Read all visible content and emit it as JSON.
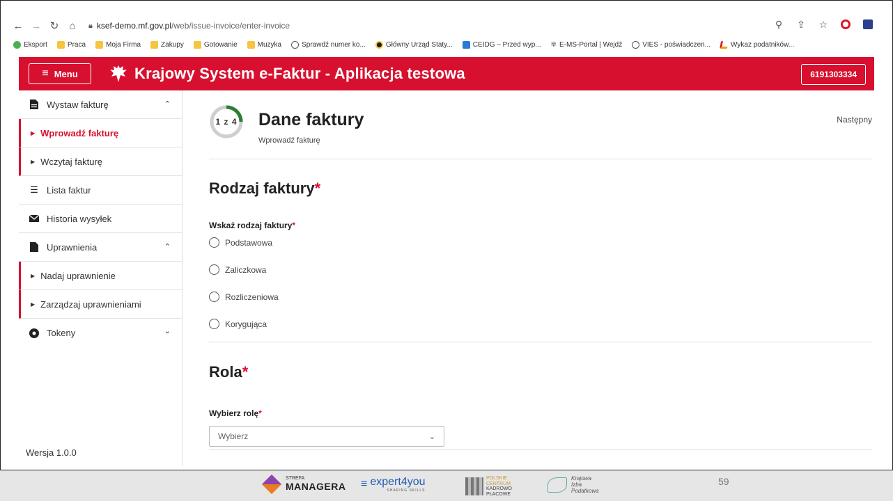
{
  "browser": {
    "url_host": "ksef-demo.mf.gov.pl",
    "url_path": "/web/issue-invoice/enter-invoice",
    "bookmarks": [
      {
        "label": "Eksport",
        "icon": "green-globe"
      },
      {
        "label": "Praca",
        "icon": "folder"
      },
      {
        "label": "Moja Firma",
        "icon": "folder"
      },
      {
        "label": "Zakupy",
        "icon": "folder"
      },
      {
        "label": "Gotowanie",
        "icon": "folder"
      },
      {
        "label": "Muzyka",
        "icon": "folder"
      },
      {
        "label": "Sprawdź numer ko...",
        "icon": "globe"
      },
      {
        "label": "Główny Urząd Staty...",
        "icon": "dot-yellow"
      },
      {
        "label": "CEIDG – Przed wyp...",
        "icon": "ceidg"
      },
      {
        "label": "E-MS-Portal | Wejdź",
        "icon": "eagle-sm"
      },
      {
        "label": "VIES - poświadczen...",
        "icon": "globe"
      },
      {
        "label": "Wykaz podatników...",
        "icon": "wykaz"
      }
    ]
  },
  "header": {
    "menu_label": "Menu",
    "title": "Krajowy System e-Faktur - Aplikacja testowa",
    "nip": "6191303334"
  },
  "sidebar": {
    "wystaw": "Wystaw fakturę",
    "wprowadz": "Wprowadź fakturę",
    "wczytaj": "Wczytaj fakturę",
    "lista": "Lista faktur",
    "historia": "Historia wysyłek",
    "uprawnienia": "Uprawnienia",
    "nadaj": "Nadaj uprawnienie",
    "zarzadzaj": "Zarządzaj uprawnieniami",
    "tokeny": "Tokeny",
    "version": "Wersja 1.0.0"
  },
  "main": {
    "step_text": "1 z 4",
    "step_progress": 0.25,
    "title": "Dane faktury",
    "subtitle": "Wprowadź fakturę",
    "next": "Następny",
    "section_type": "Rodzaj faktury",
    "type_label": "Wskaż rodzaj faktury",
    "options": [
      "Podstawowa",
      "Zaliczkowa",
      "Rozliczeniowa",
      "Korygująca"
    ],
    "section_role": "Rola",
    "role_label": "Wybierz rolę",
    "role_placeholder": "Wybierz",
    "required_mark": "*"
  },
  "footer": {
    "strefa_small": "STREFA",
    "strefa": "MANAGERA",
    "expert": "expert4you",
    "expert_sub": "SHARING SKILLS",
    "pckp1": "POLSKIE",
    "pckp2": "CENTRUM",
    "pckp3": "KADROWO",
    "pckp4": "PŁACOWE",
    "kip1": "Krajowa",
    "kip2": "Izba",
    "kip3": "Podatkowa",
    "slide_number": "59"
  },
  "colors": {
    "brand_red": "#d8102f",
    "progress_green": "#2e7d32",
    "progress_track": "#cfcfcf"
  }
}
